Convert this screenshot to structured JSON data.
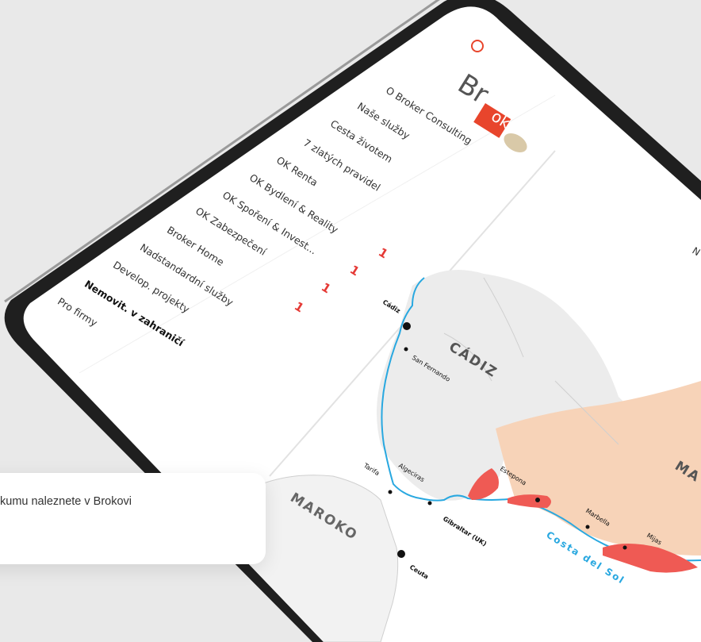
{
  "logo": {
    "text_br": "Br",
    "text_ok": "ok"
  },
  "menu": [
    {
      "label": "O Broker Consulting",
      "active": false
    },
    {
      "label": "Naše služby",
      "active": false
    },
    {
      "label": "Cesta životem",
      "active": false
    },
    {
      "label": "7 zlatých pravidel",
      "active": false
    },
    {
      "label": "OK Renta",
      "active": false
    },
    {
      "label": "OK Bydlení & Reality",
      "active": false
    },
    {
      "label": "OK Spoření & Invest...",
      "active": false
    },
    {
      "label": "OK Zabezpečení",
      "active": false
    },
    {
      "label": "Broker Home",
      "active": false
    },
    {
      "label": "Nadstandardní služby",
      "active": false
    },
    {
      "label": "Develop. projekty",
      "active": false
    },
    {
      "label": "Nemovit. v zahraničí",
      "active": true
    },
    {
      "label": "Pro firmy",
      "active": false
    }
  ],
  "badges": [
    "1",
    "1",
    "1",
    "1"
  ],
  "header_partial": "N",
  "map": {
    "region_cadiz": "CÁDIZ",
    "region_malaga_partial": "MA",
    "country_maroko": "MAROKO",
    "coast": "Costa del Sol",
    "cities": [
      "Cádiz",
      "San Fernando",
      "Tarifa",
      "Algeciras",
      "Estepona",
      "Gibraltar (UK)",
      "Ceuta",
      "Marbella",
      "Mijas"
    ]
  },
  "caption": {
    "text": "kumu naleznete v Brokovi"
  },
  "colors": {
    "accent": "#e8452c",
    "sea_line": "#29a8e0",
    "cadiz_fill": "#ececec",
    "malaga_fill": "#f7d3b8",
    "highlight": "#ef5a54"
  }
}
